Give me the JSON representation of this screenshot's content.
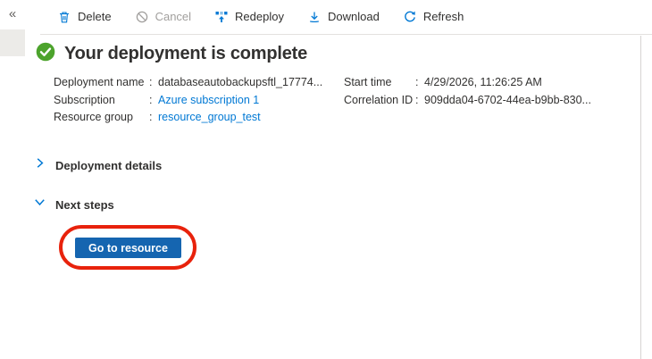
{
  "colors": {
    "accent_blue": "#0078d4",
    "success_green": "#4ca32c",
    "button_blue": "#1565b0",
    "annotation_red": "#e8220c",
    "disabled_gray": "#a19f9d"
  },
  "panel": {
    "collapse_icon": "«"
  },
  "toolbar": {
    "items": [
      {
        "label": "Delete",
        "enabled": true
      },
      {
        "label": "Cancel",
        "enabled": false
      },
      {
        "label": "Redeploy",
        "enabled": true
      },
      {
        "label": "Download",
        "enabled": true
      },
      {
        "label": "Refresh",
        "enabled": true
      }
    ]
  },
  "status": {
    "title": "Your deployment is complete"
  },
  "details": {
    "rows_left": [
      {
        "label": "Deployment name",
        "value": "databaseautobackupsftl_17774..."
      },
      {
        "label": "Subscription",
        "value": "Azure subscription 1"
      },
      {
        "label": "Resource group",
        "value": "resource_group_test"
      }
    ],
    "rows_right": [
      {
        "label": "Start time",
        "value": "4/29/2026, 11:26:25 AM"
      },
      {
        "label": "Correlation ID",
        "value": "909dda04-6702-44ea-b9bb-830..."
      }
    ]
  },
  "sections": {
    "deployment_details": "Deployment details",
    "next_steps": "Next steps"
  },
  "next_steps": {
    "go_to_resource_label": "Go to resource"
  }
}
